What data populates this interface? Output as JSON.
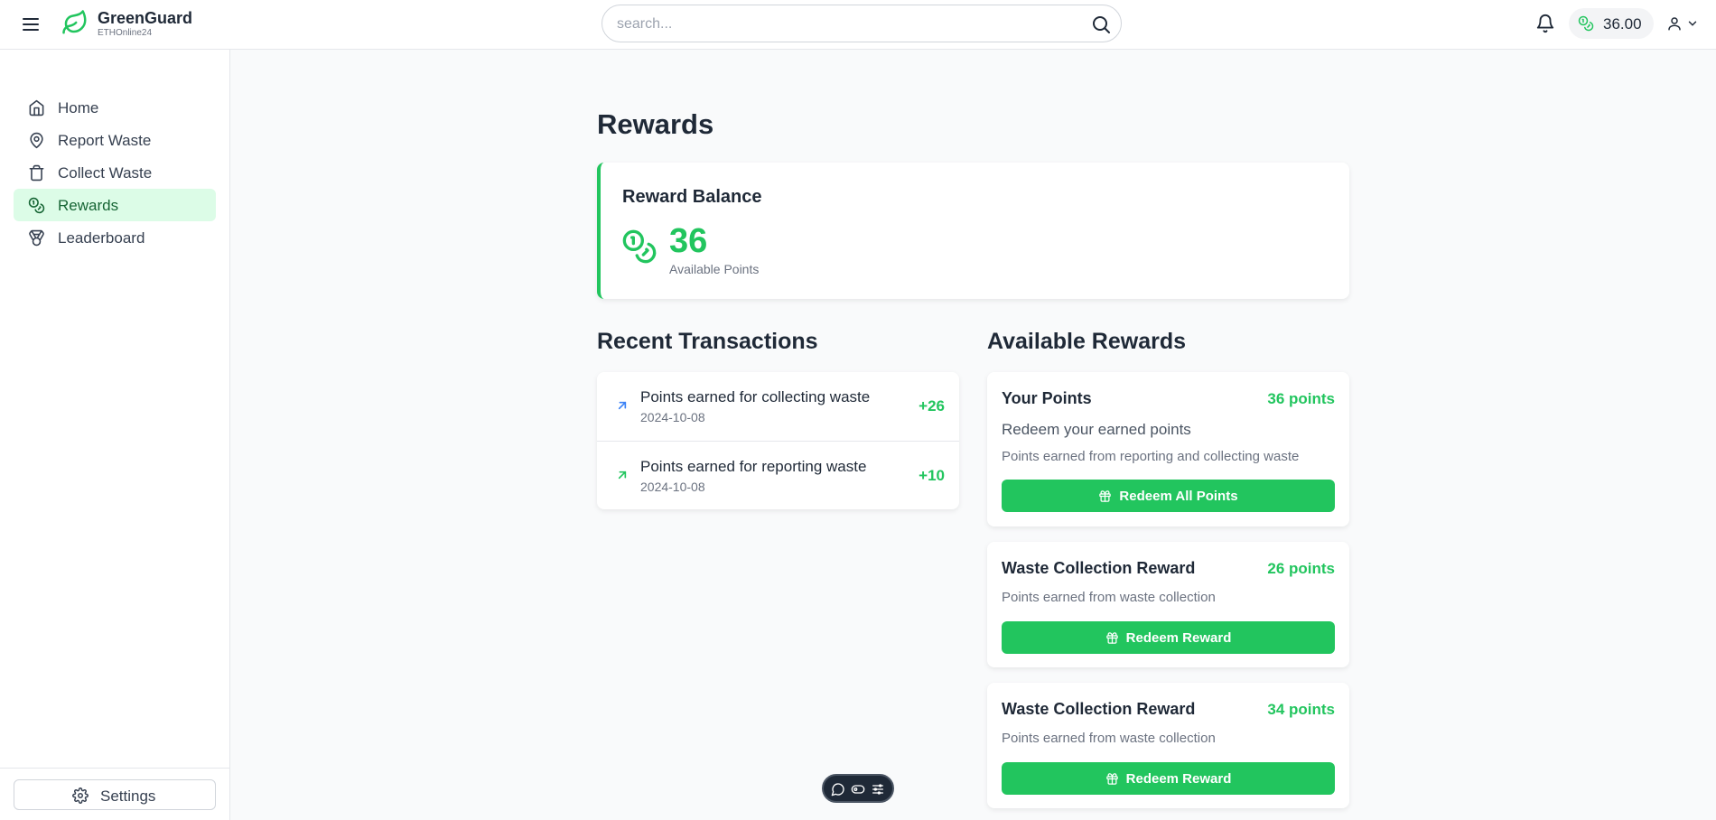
{
  "header": {
    "brand_name": "GreenGuard",
    "brand_sub": "ETHOnline24",
    "search_placeholder": "search...",
    "balance": "36.00"
  },
  "sidebar": {
    "items": [
      {
        "label": "Home",
        "icon": "home-icon"
      },
      {
        "label": "Report Waste",
        "icon": "map-pin-icon"
      },
      {
        "label": "Collect Waste",
        "icon": "trash-icon"
      },
      {
        "label": "Rewards",
        "icon": "coins-icon",
        "active": true
      },
      {
        "label": "Leaderboard",
        "icon": "medal-icon"
      }
    ],
    "settings_label": "Settings"
  },
  "main": {
    "title": "Rewards",
    "balance_card": {
      "title": "Reward Balance",
      "points": "36",
      "caption": "Available Points"
    },
    "transactions": {
      "title": "Recent Transactions",
      "items": [
        {
          "description": "Points earned for collecting waste",
          "date": "2024-10-08",
          "amount": "+26"
        },
        {
          "description": "Points earned for reporting waste",
          "date": "2024-10-08",
          "amount": "+10"
        }
      ]
    },
    "rewards": {
      "title": "Available Rewards",
      "items": [
        {
          "name": "Your Points",
          "points": "36 points",
          "subtitle": "Redeem your earned points",
          "description": "Points earned from reporting and collecting waste",
          "button": "Redeem All Points"
        },
        {
          "name": "Waste Collection Reward",
          "points": "26 points",
          "description": "Points earned from waste collection",
          "button": "Redeem Reward"
        },
        {
          "name": "Waste Collection Reward",
          "points": "34 points",
          "description": "Points earned from waste collection",
          "button": "Redeem Reward"
        }
      ]
    }
  },
  "colors": {
    "accent": "#22c55e",
    "active_bg": "#dcfce7",
    "active_text": "#166534"
  }
}
